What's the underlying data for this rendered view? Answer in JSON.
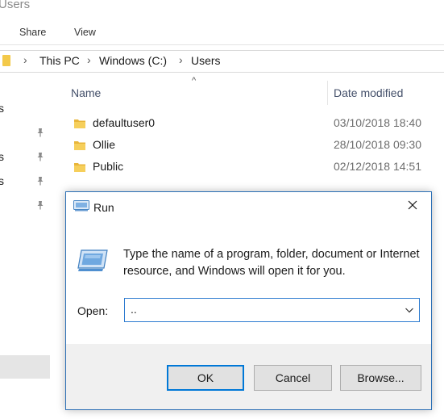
{
  "explorer": {
    "title": "Users",
    "ribbon_tabs": [
      "Share",
      "View"
    ],
    "breadcrumb": [
      "This PC",
      "Windows (C:)",
      "Users"
    ],
    "nav_partial": [
      "s",
      "s",
      "s"
    ],
    "columns": {
      "name": "Name",
      "date_modified": "Date modified"
    },
    "files": [
      {
        "name": "defaultuser0",
        "date": "03/10/2018 18:40"
      },
      {
        "name": "Ollie",
        "date": "28/10/2018 09:30"
      },
      {
        "name": "Public",
        "date": "02/12/2018 14:51"
      }
    ]
  },
  "run_dialog": {
    "title": "Run",
    "description": "Type the name of a program, folder, document or Internet resource, and Windows will open it for you.",
    "open_label": "Open:",
    "open_value": "..",
    "buttons": {
      "ok": "OK",
      "cancel": "Cancel",
      "browse": "Browse..."
    }
  },
  "colors": {
    "folder": "#f3c94a",
    "dialog_border": "#2b6fb5",
    "default_button_border": "#0078d7",
    "footer_bg": "#f0f0f0"
  },
  "icons": [
    "folder-icon",
    "pin-icon",
    "chevron-right-icon",
    "caret-up-icon",
    "run-icon",
    "close-icon",
    "chevron-down-icon"
  ]
}
